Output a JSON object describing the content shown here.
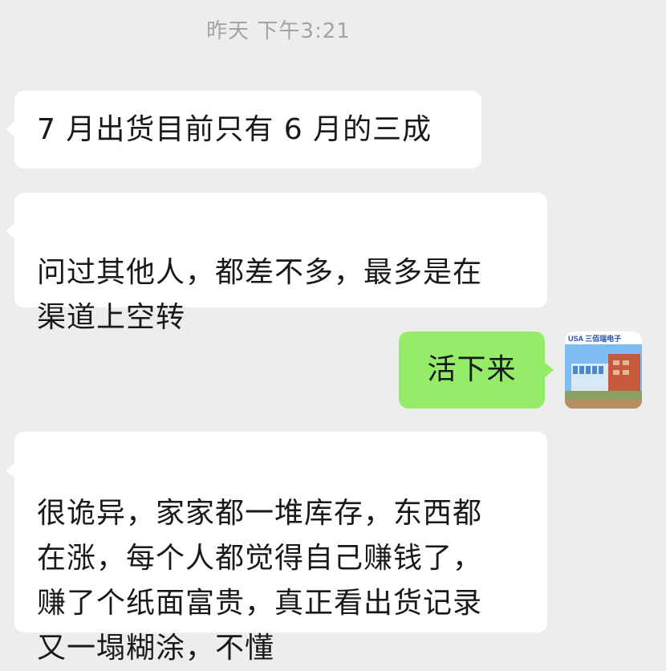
{
  "timestamp": "昨天 下午3:21",
  "messages": [
    {
      "side": "left",
      "text": "7 月出货目前只有 6 月的三成"
    },
    {
      "side": "left",
      "text": "问过其他人，都差不多，最多是在\n渠道上空转"
    },
    {
      "side": "right",
      "text": "活下来"
    },
    {
      "side": "left",
      "text": "很诡异，家家都一堆库存，东西都\n在涨，每个人都觉得自己赚钱了，\n赚了个纸面富贵，真正看出货记录\n又一塌糊涂，不懂"
    }
  ],
  "avatar": {
    "icon": "company-building-avatar-icon",
    "logo_text": "USA 三佰瑞电子"
  },
  "colors": {
    "background": "#ededed",
    "incoming_bubble": "#ffffff",
    "outgoing_bubble": "#95ec69",
    "timestamp": "#a3a3a3"
  }
}
